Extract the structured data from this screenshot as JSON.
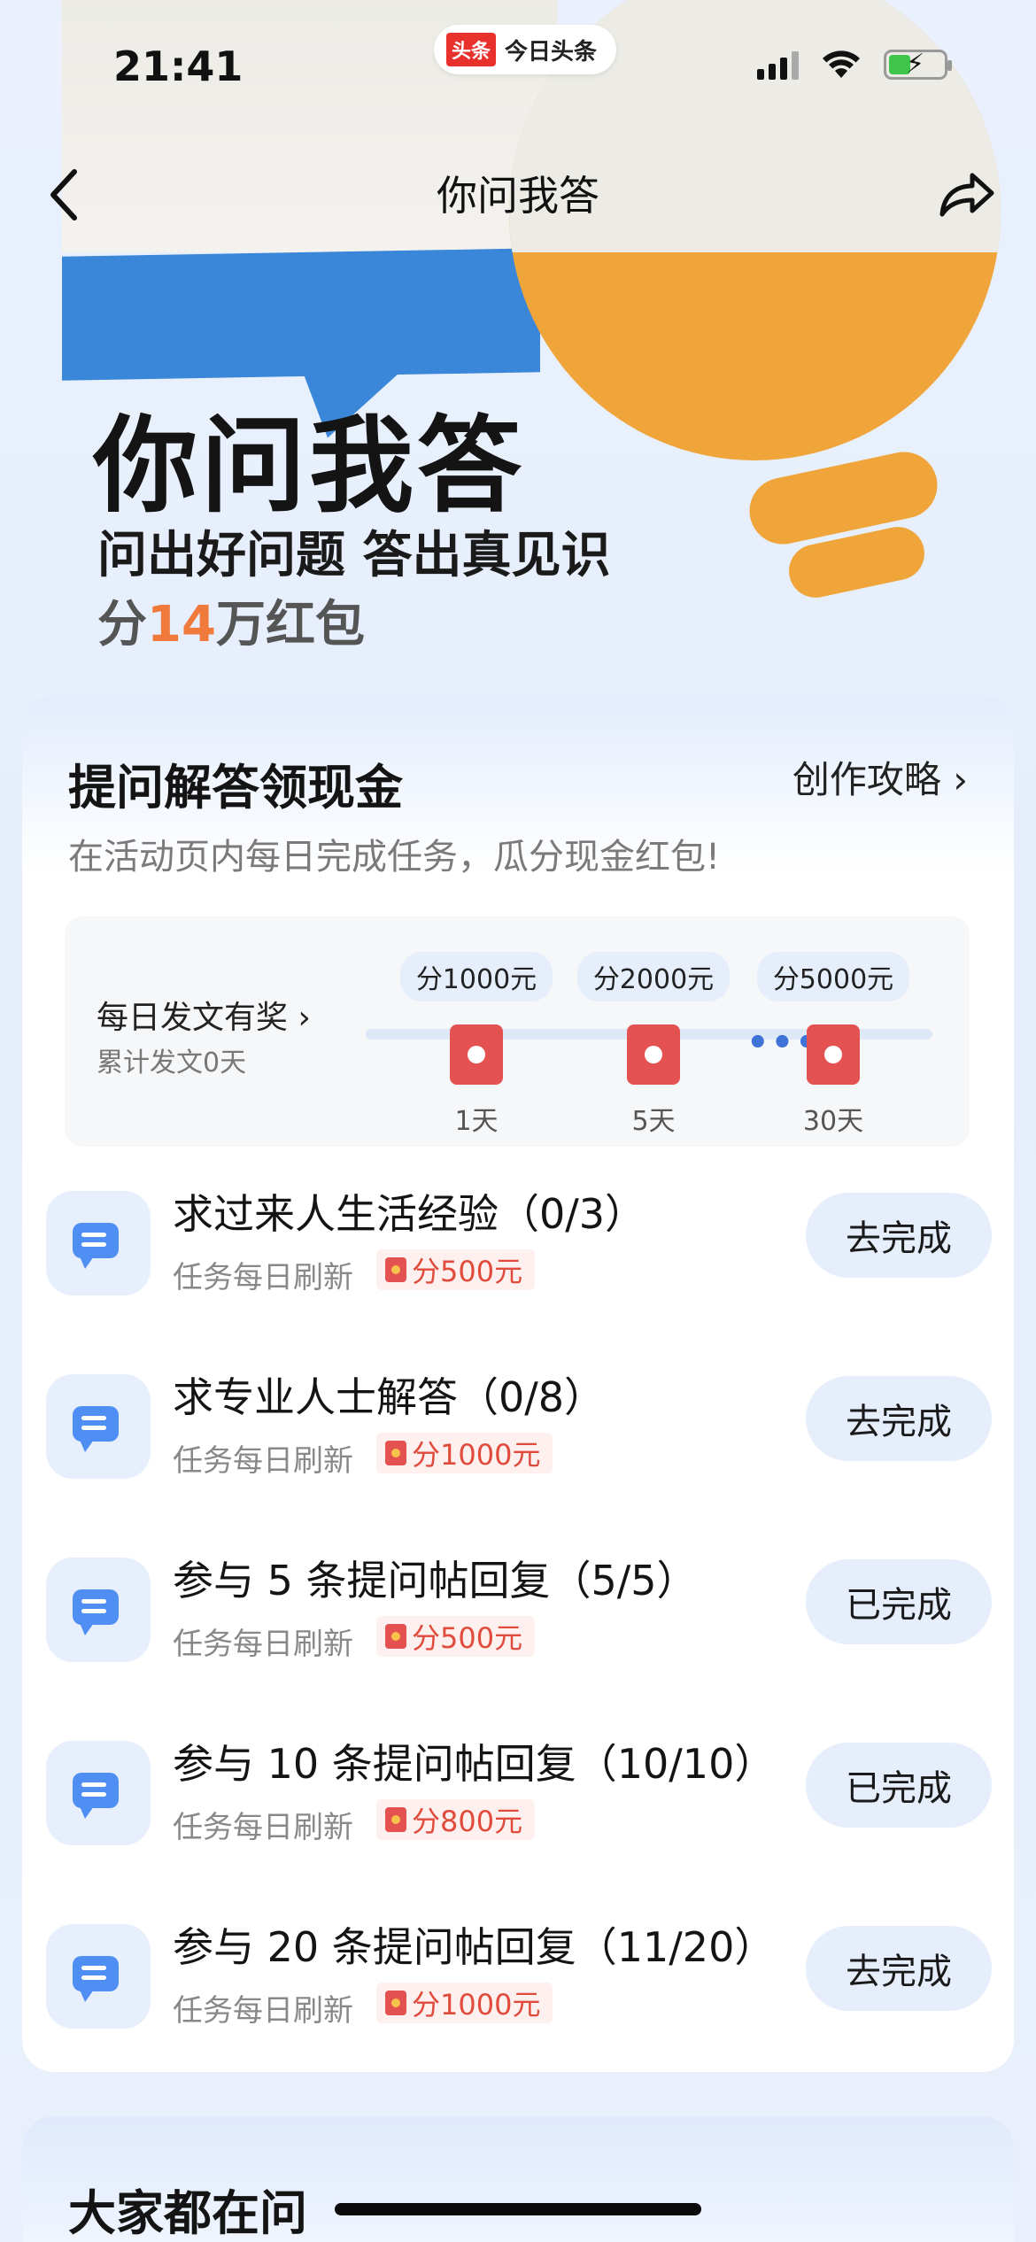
{
  "status_bar": {
    "time": "21:41",
    "app_logo": "头条",
    "app_name": "今日头条"
  },
  "nav": {
    "back_icon": "chevron-left-icon",
    "title": "你问我答",
    "share_icon": "share-icon"
  },
  "hero": {
    "title": "你问我答",
    "subtitle": "问出好问题 答出真见识",
    "prize_prefix": "分",
    "prize_number": "14",
    "prize_suffix": "万红包"
  },
  "task_card": {
    "title": "提问解答领现金",
    "guide_link": "创作攻略 ›",
    "description": "在活动页内每日完成任务，瓜分现金红包!",
    "streak": {
      "label": "每日发文有奖 ›",
      "count": "累计发文0天",
      "milestones": [
        {
          "prize": "分1000元",
          "day": "1天"
        },
        {
          "prize": "分2000元",
          "day": "5天"
        },
        {
          "prize": "分5000元",
          "day": "30天"
        }
      ],
      "dots": "•••"
    },
    "tasks": [
      {
        "name": "求过来人生活经验（0/3）",
        "refresh": "任务每日刷新",
        "reward": "分500元",
        "button": "去完成"
      },
      {
        "name": "求专业人士解答（0/8）",
        "refresh": "任务每日刷新",
        "reward": "分1000元",
        "button": "去完成"
      },
      {
        "name": "参与 5 条提问帖回复（5/5）",
        "refresh": "任务每日刷新",
        "reward": "分500元",
        "button": "已完成"
      },
      {
        "name": "参与 10 条提问帖回复（10/10）",
        "refresh": "任务每日刷新",
        "reward": "分800元",
        "button": "已完成"
      },
      {
        "name": "参与 20 条提问帖回复（11/20）",
        "refresh": "任务每日刷新",
        "reward": "分1000元",
        "button": "去完成"
      }
    ]
  },
  "popular_card": {
    "title": "大家都在问"
  },
  "colors": {
    "accent_red": "#e45151",
    "button_bg": "#e6eefc",
    "icon_blue": "#4f8ef3",
    "prize_orange": "#f07a3c"
  }
}
